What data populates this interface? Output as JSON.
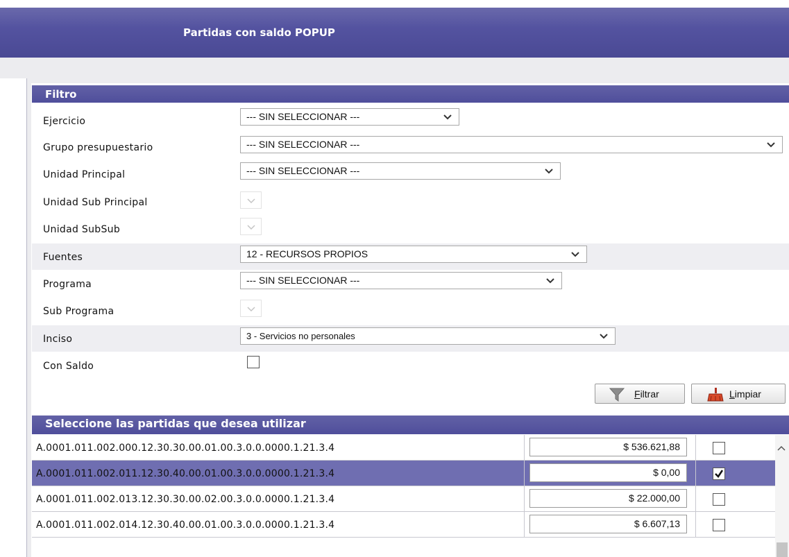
{
  "window": {
    "title": "Partidas con saldo POPUP"
  },
  "filter": {
    "header": "Filtro",
    "fields": {
      "ejercicio": {
        "label": "Ejercicio",
        "value": "--- SIN SELECCIONAR ---"
      },
      "grupo": {
        "label": "Grupo presupuestario",
        "value": "--- SIN SELECCIONAR ---"
      },
      "unidad_principal": {
        "label": "Unidad Principal",
        "value": "--- SIN SELECCIONAR ---"
      },
      "unidad_sub_principal": {
        "label": "Unidad Sub Principal",
        "value": ""
      },
      "unidad_subsub": {
        "label": "Unidad SubSub",
        "value": ""
      },
      "fuentes": {
        "label": "Fuentes",
        "value": "12 - RECURSOS PROPIOS"
      },
      "programa": {
        "label": "Programa",
        "value": "--- SIN SELECCIONAR ---"
      },
      "sub_programa": {
        "label": "Sub Programa",
        "value": ""
      },
      "inciso": {
        "label": "Inciso",
        "value": "3 - Servicios no personales"
      },
      "con_saldo": {
        "label": "Con Saldo",
        "checked": false
      }
    },
    "buttons": {
      "filtrar": "Filtrar",
      "limpiar": "Limpiar"
    }
  },
  "results": {
    "header": "Seleccione las partidas que desea utilizar",
    "rows": [
      {
        "code": "A.0001.011.002.000.12.30.30.00.01.00.3.0.0.0000.1.21.3.4",
        "amount": "$ 536.621,88",
        "checked": false,
        "selected": false
      },
      {
        "code": "A.0001.011.002.011.12.30.40.00.01.00.3.0.0.0000.1.21.3.4",
        "amount": "$ 0,00",
        "checked": true,
        "selected": true
      },
      {
        "code": "A.0001.011.002.013.12.30.30.00.02.00.3.0.0.0000.1.21.3.4",
        "amount": "$ 22.000,00",
        "checked": false,
        "selected": false
      },
      {
        "code": "A.0001.011.002.014.12.30.40.00.01.00.3.0.0.0000.1.21.3.4",
        "amount": "$ 6.607,13",
        "checked": false,
        "selected": false
      }
    ]
  },
  "colors": {
    "header": "#5453a0",
    "selected_row": "#6f6eb1"
  }
}
